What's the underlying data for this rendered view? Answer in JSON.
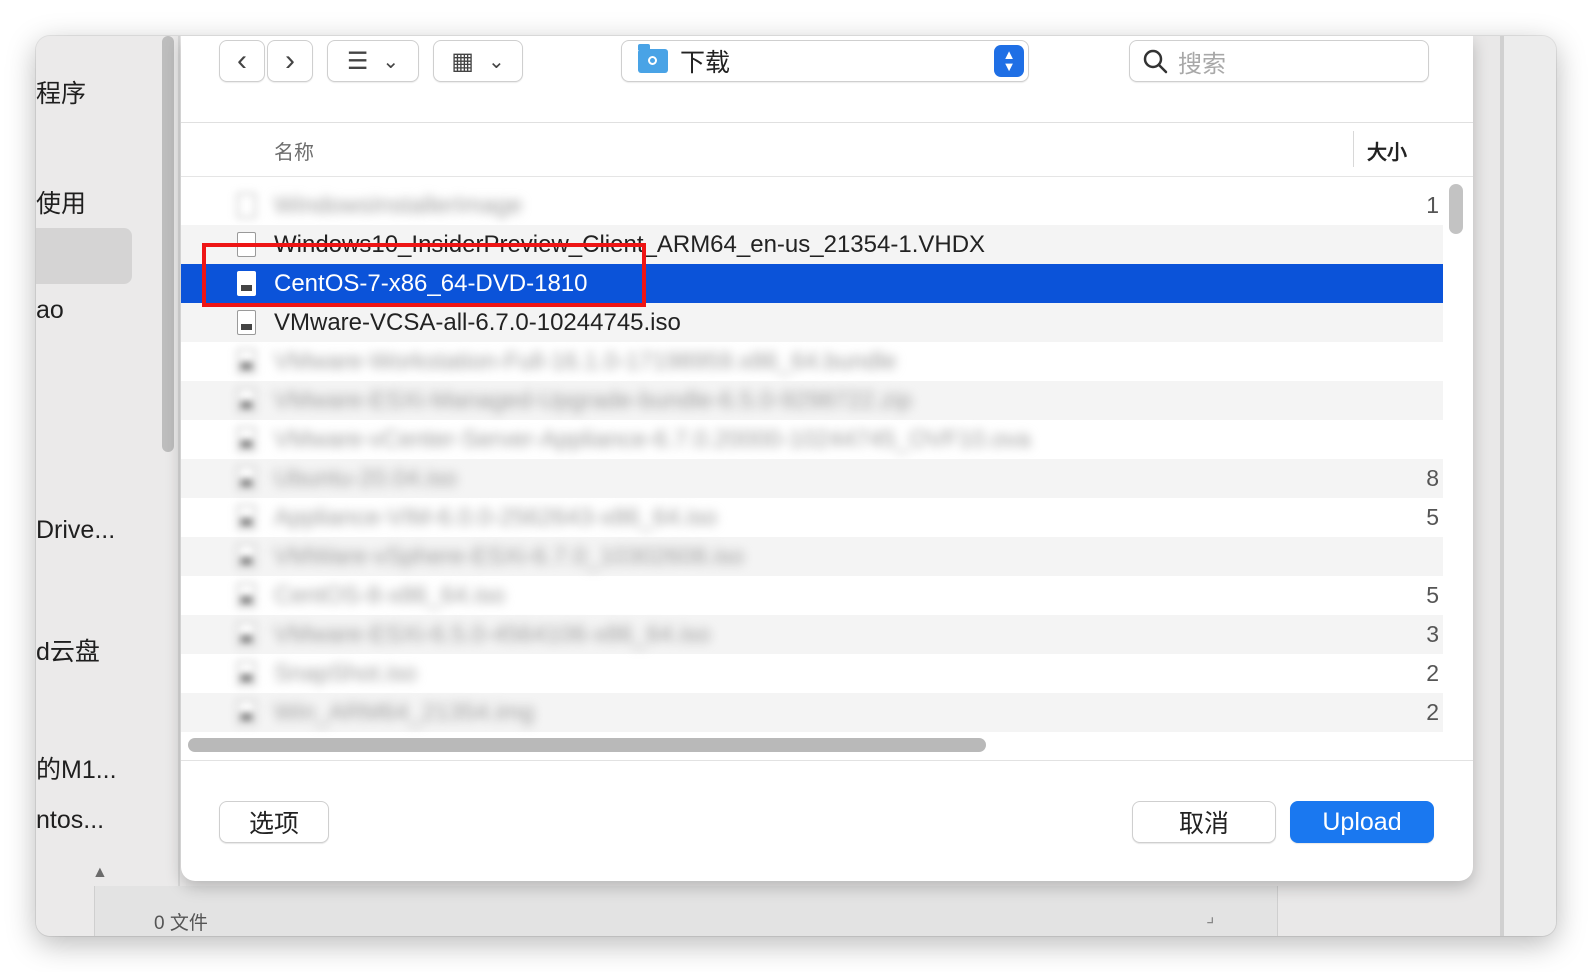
{
  "sidebar": {
    "items": [
      {
        "label": "程序"
      },
      {
        "label": "使用"
      },
      {
        "label": "ao"
      },
      {
        "label": "Drive..."
      },
      {
        "label": "d云盘"
      },
      {
        "label": "的M1..."
      },
      {
        "label": "ntos..."
      }
    ]
  },
  "toolbar": {
    "back_icon": "‹",
    "forward_icon": "›",
    "list_view_icon": "☰",
    "grid_view_icon": "▦",
    "chevron_icon": "⌄",
    "location": "下载",
    "search_placeholder": "搜索"
  },
  "columns": {
    "name": "名称",
    "size": "大小"
  },
  "files": [
    {
      "name": "WindowsInstallerImage",
      "size": "1",
      "blurred": true,
      "iso": false
    },
    {
      "name": "Windows10_InsiderPreview_Client_ARM64_en-us_21354-1.VHDX",
      "size": "",
      "blurred": false,
      "iso": false
    },
    {
      "name": "CentOS-7-x86_64-DVD-1810",
      "size": "",
      "blurred": false,
      "iso": true,
      "selected": true
    },
    {
      "name": "VMware-VCSA-all-6.7.0-10244745.iso",
      "size": "",
      "blurred": false,
      "iso": true
    },
    {
      "name": "VMware-Workstation-Full-16.1.0-17198959.x86_64.bundle",
      "size": "",
      "blurred": true,
      "iso": true
    },
    {
      "name": "VMware-ESXi-Managed-Upgrade-bundle-6.5.0-9298722.zip",
      "size": "",
      "blurred": true,
      "iso": true
    },
    {
      "name": "VMware-vCenter-Server-Appliance-6.7.0.20000-10244745_OVF10.ova",
      "size": "",
      "blurred": true,
      "iso": true
    },
    {
      "name": "Ubuntu-20.04.iso",
      "size": "8",
      "blurred": true,
      "iso": true
    },
    {
      "name": "Appliance-VIM-6.0.0-2562643-x86_64.iso",
      "size": "5",
      "blurred": true,
      "iso": true
    },
    {
      "name": "VMWare-vSphere-ESXi-6.7.0_10302608.iso",
      "size": "",
      "blurred": true,
      "iso": true
    },
    {
      "name": "CentOS-8-x86_64.iso",
      "size": "5",
      "blurred": true,
      "iso": true
    },
    {
      "name": "VMware-ESXi-6.5.0-4564106-x86_64.iso",
      "size": "3",
      "blurred": true,
      "iso": true
    },
    {
      "name": "SnapShot.iso",
      "size": "2",
      "blurred": true,
      "iso": true
    },
    {
      "name": "Win_ARM64_21354.img",
      "size": "2",
      "blurred": true,
      "iso": true
    }
  ],
  "buttons": {
    "options": "选项",
    "cancel": "取消",
    "upload": "Upload"
  },
  "status": {
    "text": "0 文件"
  },
  "colors": {
    "selection": "#0b53d9",
    "primary_button": "#1a78f0",
    "highlight_box": "#ee1515"
  }
}
